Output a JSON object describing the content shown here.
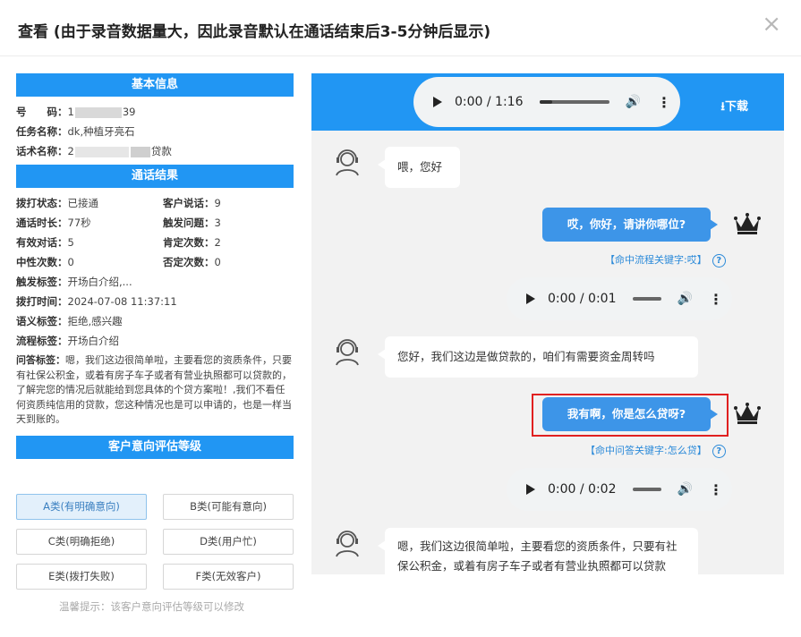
{
  "modal": {
    "title": "查看 (由于录音数据量大，因此录音默认在通话结束后3-5分钟后显示)",
    "close": "×"
  },
  "basic": {
    "header": "基本信息",
    "phone_label": "号　　码：",
    "phone_prefix": "1",
    "phone_suffix": "39",
    "task_label": "任务名称：",
    "task_value": "dk,种植牙亮石",
    "script_label": "话术名称：",
    "script_prefix": "2",
    "script_suffix": "贷款"
  },
  "result": {
    "header": "通话结果",
    "rows": [
      {
        "l1": "拨打状态：",
        "v1": "已接通",
        "l2": "客户说话：",
        "v2": "9"
      },
      {
        "l1": "通话时长：",
        "v1": "77秒",
        "l2": "触发问题：",
        "v2": "3"
      },
      {
        "l1": "有效对话：",
        "v1": "5",
        "l2": "肯定次数：",
        "v2": "2"
      },
      {
        "l1": "中性次数：",
        "v1": "0",
        "l2": "否定次数：",
        "v2": "0"
      }
    ],
    "trigger_label": "触发标签：",
    "trigger_value": "开场白介绍,...",
    "time_label": "拨打时间：",
    "time_value": "2024-07-08 11:37:11",
    "semantic_label": "语义标签：",
    "semantic_value": "拒绝,感兴趣",
    "flow_label": "流程标签：",
    "flow_value": "开场白介绍",
    "qa_label": "问答标签：",
    "qa_value": "嗯，我们这边很简单啦，主要看您的资质条件，只要有社保公积金，或着有房子车子或者有营业执照都可以贷款的，了解完您的情况后就能给到您具体的个贷方案啦！,我们不看任何资质纯信用的贷款，您这种情况也是可以申请的，也是一样当天到账的。"
  },
  "grade": {
    "header": "客户意向评估等级",
    "buttons": [
      "A类(有明确意向)",
      "B类(可能有意向)",
      "C类(明确拒绝)",
      "D类(用户忙)",
      "E类(拨打失败)",
      "F类(无效客户)"
    ],
    "selected": "A类(有明确意向)",
    "tip": "温馨提示：该客户意向评估等级可以修改"
  },
  "player": {
    "main_time": "0:00 / 1:16",
    "main_progress": 0.18,
    "download": "下载"
  },
  "chat": {
    "msgs": [
      {
        "side": "left",
        "text": "喂，您好"
      },
      {
        "side": "right",
        "text": "哎，你好，请讲你哪位?",
        "hit": "【命中流程关键字:哎】",
        "audio": "0:00 / 0:01"
      },
      {
        "side": "left",
        "text": "您好，我们这边是做贷款的，咱们有需要资金周转吗"
      },
      {
        "side": "right",
        "text": "我有啊，你是怎么贷呀?",
        "hit": "【命中问答关键字:怎么贷】",
        "audio": "0:00 / 0:02"
      },
      {
        "side": "left",
        "text": "嗯，我们这边很简单啦，主要看您的资质条件，只要有社保公积金，或着有房子车子或者有营业执照都可以贷款"
      }
    ],
    "hit_help": "?"
  },
  "colors": {
    "accent": "#2196f3",
    "bubble_right": "#3d95e8",
    "highlight": "#e02020"
  }
}
